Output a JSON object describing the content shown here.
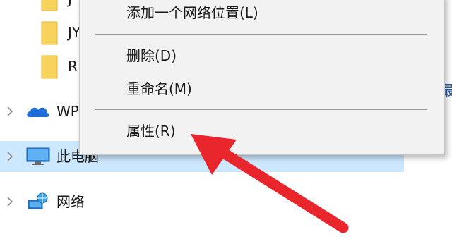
{
  "nav": {
    "folders": [
      {
        "label": "J"
      },
      {
        "label": "JY"
      },
      {
        "label": "R"
      }
    ],
    "items": [
      {
        "label": "WP",
        "icon": "cloud-icon"
      },
      {
        "label": "此电脑",
        "icon": "computer-icon"
      },
      {
        "label": "网络",
        "icon": "network-icon"
      }
    ]
  },
  "right_edge_text": "最",
  "context_menu": {
    "items": [
      {
        "label": "添加一个网络位置(L)"
      },
      {
        "label": "删除(D)"
      },
      {
        "label": "重命名(M)"
      },
      {
        "label": "属性(R)"
      }
    ]
  },
  "colors": {
    "selection": "#cce8ff",
    "arrow": "#e8262b",
    "menu_background": "#f2f2f2",
    "folder": "#f7d35e"
  }
}
